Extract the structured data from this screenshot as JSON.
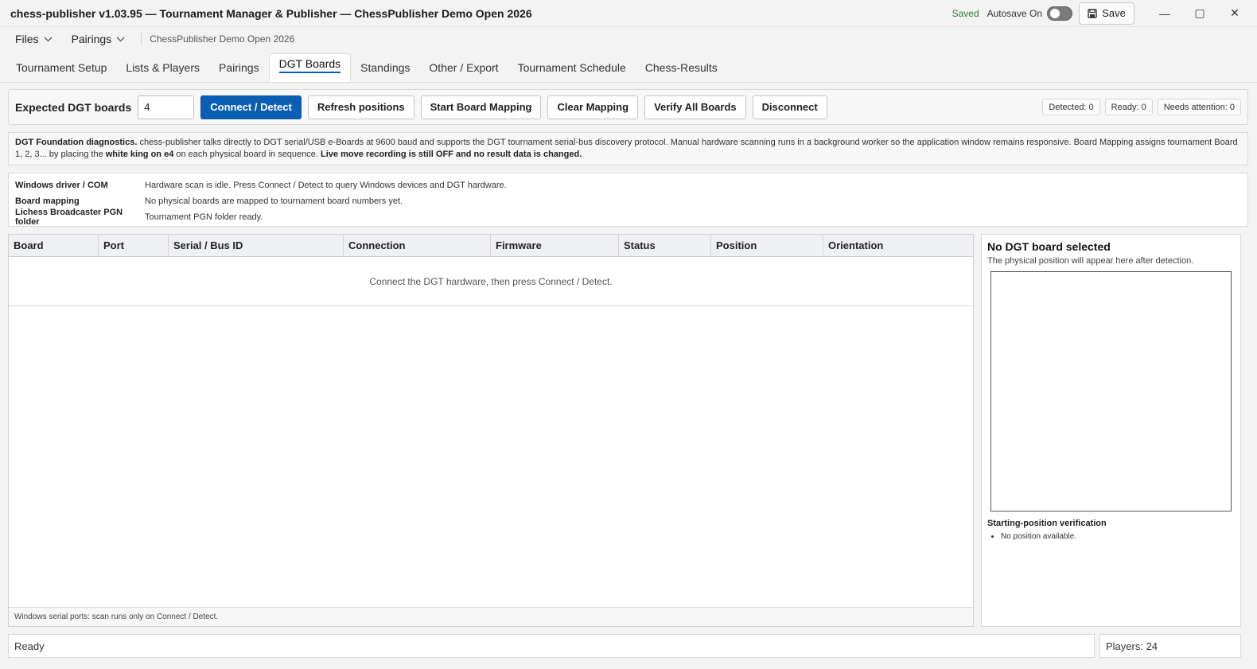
{
  "window": {
    "title": "chess-publisher v1.03.95 — Tournament Manager & Publisher — ChessPublisher Demo Open 2026",
    "saved_label": "Saved",
    "autosave_label": "Autosave On",
    "autosave_on": false,
    "save_label": "Save",
    "minimize_glyph": "—",
    "maximize_glyph": "▢",
    "close_glyph": "✕"
  },
  "menu": {
    "items": [
      {
        "label": "Files",
        "icon": "chevron-down-icon"
      },
      {
        "label": "Pairings",
        "icon": "chevron-down-icon"
      }
    ],
    "breadcrumb": "ChessPublisher Demo Open 2026"
  },
  "tabs": [
    {
      "label": "Tournament Setup",
      "active": false
    },
    {
      "label": "Lists & Players",
      "active": false
    },
    {
      "label": "Pairings",
      "active": false
    },
    {
      "label": "DGT Boards",
      "active": true
    },
    {
      "label": "Standings",
      "active": false
    },
    {
      "label": "Other / Export",
      "active": false
    },
    {
      "label": "Tournament Schedule",
      "active": false
    },
    {
      "label": "Chess-Results",
      "active": false
    }
  ],
  "toolbar": {
    "expected_label": "Expected DGT boards",
    "expected_value": "4",
    "buttons": {
      "connect": "Connect / Detect",
      "refresh": "Refresh positions",
      "mapping": "Start Board Mapping",
      "clear": "Clear Mapping",
      "verify": "Verify All Boards",
      "disconnect": "Disconnect"
    },
    "counters": {
      "detected": "Detected: 0",
      "ready": "Ready: 0",
      "attention": "Needs attention: 0"
    }
  },
  "diagnostics": {
    "heading": "DGT Foundation diagnostics.",
    "text1": " chess-publisher talks directly to DGT serial/USB e-Boards at 9600 baud and supports the DGT tournament serial-bus discovery protocol. Manual hardware scanning runs in a background worker so the application window remains responsive. Board Mapping assigns tournament Board 1, 2, 3... by placing the ",
    "bold1": "white king on e4",
    "text2": " on each physical board in sequence. ",
    "bold2": "Live move recording is still OFF and no result data is changed."
  },
  "info": {
    "rows": [
      {
        "key": "Windows driver / COM",
        "value": "Hardware scan is idle. Press Connect / Detect to query Windows devices and DGT hardware."
      },
      {
        "key": "Board mapping",
        "value": "No physical boards are mapped to tournament board numbers yet."
      },
      {
        "key": "Lichess Broadcaster PGN folder",
        "value": "Tournament PGN folder ready."
      }
    ]
  },
  "table": {
    "columns": [
      "Board",
      "Port",
      "Serial / Bus ID",
      "Connection",
      "Firmware",
      "Status",
      "Position",
      "Orientation"
    ],
    "empty_message": "Connect the DGT hardware, then press Connect / Detect.",
    "footer": "Windows serial ports: scan runs only on Connect / Detect."
  },
  "side": {
    "title": "No DGT board selected",
    "subtitle": "The physical position will appear here after detection.",
    "verify_title": "Starting-position verification",
    "verify_items": [
      "No position available."
    ]
  },
  "status": {
    "left": "Ready",
    "right": "Players: 24"
  }
}
